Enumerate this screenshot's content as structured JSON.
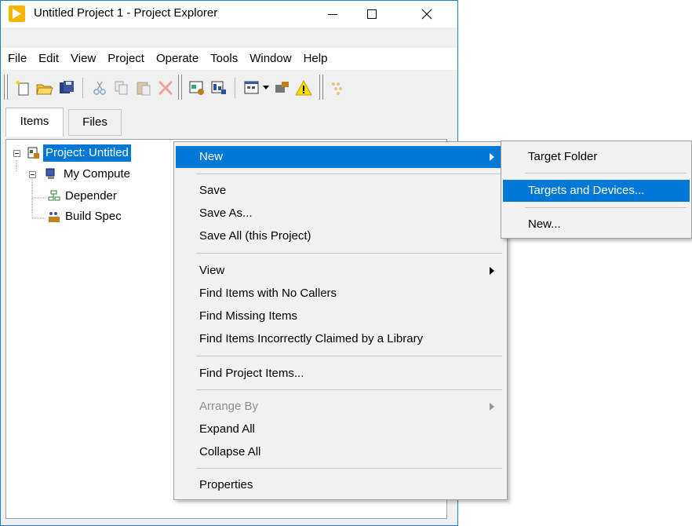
{
  "window": {
    "title": "Untitled Project 1 - Project Explorer",
    "accent": "#0078d7"
  },
  "menubar": [
    "File",
    "Edit",
    "View",
    "Project",
    "Operate",
    "Tools",
    "Window",
    "Help"
  ],
  "tabs": [
    {
      "label": "Items",
      "active": true
    },
    {
      "label": "Files",
      "active": false
    }
  ],
  "tree": {
    "project_label": "Project: Untitled",
    "computer_label": "My Compute",
    "dependencies_label": "Depender",
    "build_label": "Build Spec"
  },
  "context_menu": {
    "items": [
      {
        "label": "New",
        "submenu": true,
        "highlighted": true
      },
      {
        "label": "Save"
      },
      {
        "label": "Save As..."
      },
      {
        "label": "Save All (this Project)"
      },
      {
        "label": "View",
        "submenu": true
      },
      {
        "label": "Find Items with No Callers"
      },
      {
        "label": "Find Missing Items"
      },
      {
        "label": "Find Items Incorrectly Claimed by a Library"
      },
      {
        "label": "Find Project Items..."
      },
      {
        "label": "Arrange By",
        "submenu": true,
        "disabled": true
      },
      {
        "label": "Expand All"
      },
      {
        "label": "Collapse All"
      },
      {
        "label": "Properties"
      }
    ]
  },
  "submenu": {
    "items": [
      {
        "label": "Target Folder"
      },
      {
        "label": "Targets and Devices...",
        "highlighted": true
      },
      {
        "label": "New..."
      }
    ]
  },
  "icons": [
    "labview-app-icon",
    "minimize-icon",
    "maximize-icon",
    "close-icon",
    "new-icon",
    "open-icon",
    "save-all-icon",
    "cut-icon",
    "copy-icon",
    "paste-icon",
    "delete-icon",
    "project-settings-icon",
    "build-icon",
    "window-grid-icon",
    "tools-icon",
    "warning-icon",
    "dim-icon"
  ]
}
